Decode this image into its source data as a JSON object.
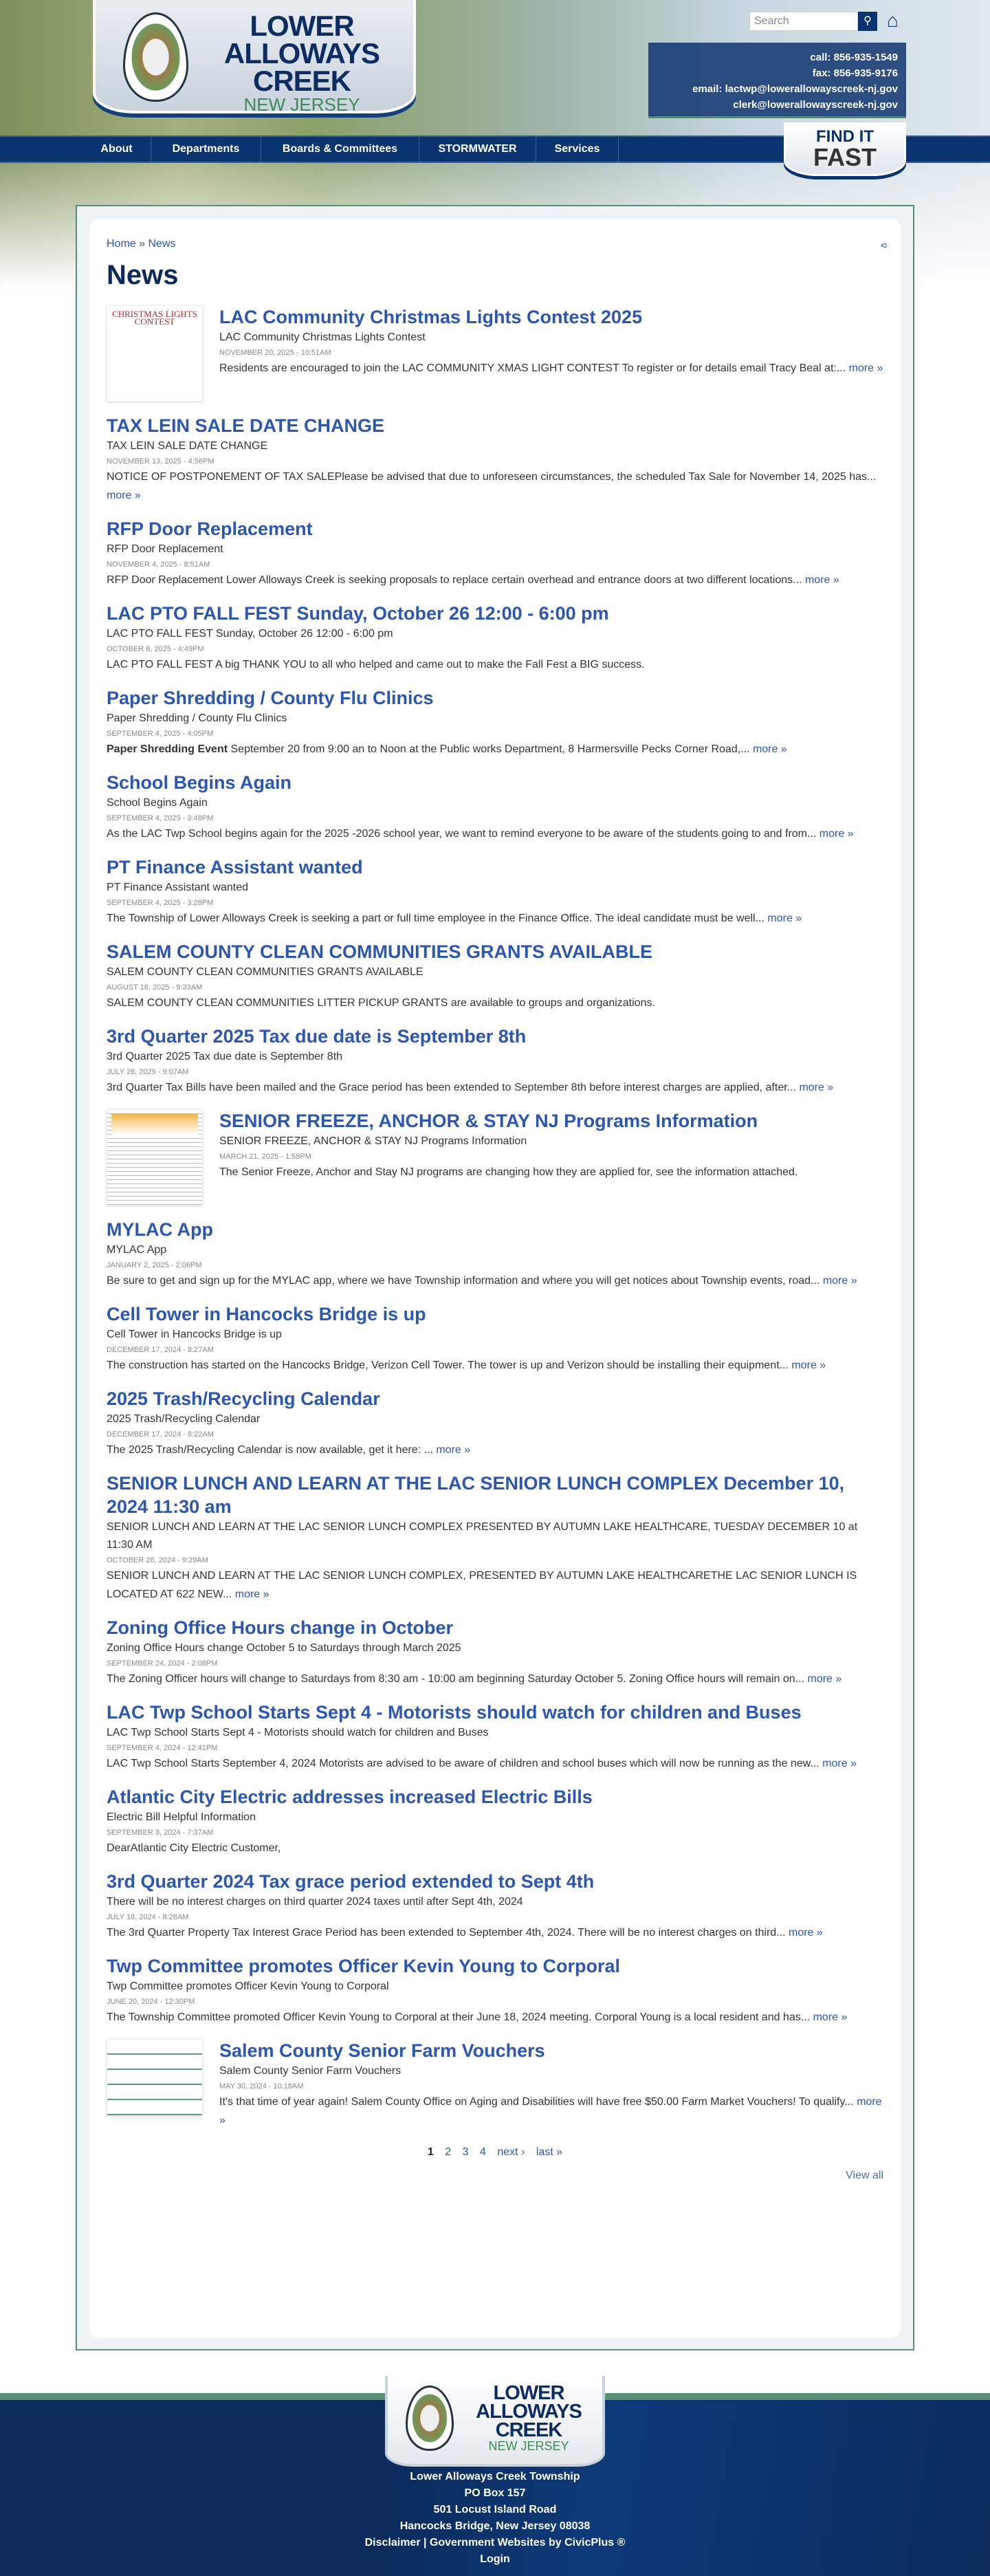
{
  "header": {
    "logo": {
      "line1": "LOWER",
      "line2": "ALLOWAYS",
      "line3": "CREEK",
      "line4": "NEW JERSEY"
    },
    "search_placeholder": "Search",
    "contact": [
      "call: 856-935-1549",
      "fax: 856-935-9176",
      "email: lactwp@lowerallowayscreek-nj.gov",
      "clerk@lowerallowayscreek-nj.gov"
    ],
    "nav": [
      "About",
      "Departments",
      "Boards & Committees",
      "STORMWATER",
      "Services"
    ],
    "find_it_fast": {
      "line1": "FIND IT",
      "line2": "FAST"
    }
  },
  "breadcrumb": {
    "home": "Home",
    "sep": " » ",
    "current": "News"
  },
  "page_title": "News",
  "news": [
    {
      "title": "LAC Community Christmas Lights Contest 2025",
      "subtitle": "LAC Community Christmas Lights Contest",
      "date": "November 20, 2025 - 10:51AM",
      "body": " Residents are encouraged to join the LAC COMMUNITY XMAS LIGHT CONTEST  To register or for details email Tracy Beal at:...",
      "more": "more »",
      "thumb_text": "CHRISTMAS LIGHTS CONTEST"
    },
    {
      "title": "TAX LEIN SALE DATE CHANGE",
      "subtitle": "TAX LEIN SALE DATE CHANGE",
      "date": "November 13, 2025 - 4:56PM",
      "body": "NOTICE OF POSTPONEMENT OF TAX SALEPlease be advised that due to unforeseen circumstances, the scheduled Tax Sale for November 14, 2025 has...",
      "more": "more »"
    },
    {
      "title": "RFP Door Replacement",
      "subtitle": "RFP Door Replacement",
      "date": "November 4, 2025 - 8:51AM",
      "body": "RFP Door Replacement  Lower Alloways Creek is seeking proposals to replace certain overhead and entrance doors at two different locations...",
      "more": "more »"
    },
    {
      "title": "LAC PTO FALL FEST Sunday, October 26 12:00 - 6:00 pm",
      "subtitle": "LAC PTO FALL FEST Sunday, October 26 12:00 - 6:00 pm",
      "date": "October 8, 2025 - 4:49PM",
      "body": "LAC PTO FALL FEST   A big THANK YOU to all who helped and came out to make the Fall Fest a BIG success."
    },
    {
      "title": "Paper Shredding / County Flu Clinics",
      "subtitle": "Paper Shredding / County Flu Clinics",
      "date": "September 4, 2025 - 4:05PM",
      "bold": "Paper Shredding Event",
      "body": " September 20 from 9:00 an to Noon at the Public works Department, 8 Harmersville Pecks Corner Road,...",
      "more": "more »"
    },
    {
      "title": "School Begins Again",
      "subtitle": "School Begins Again",
      "date": "September 4, 2025 - 3:48PM",
      "body": "As the LAC Twp School begins again for the 2025 -2026 school year, we want to remind everyone to be aware of the students going to and from...",
      "more": "more »"
    },
    {
      "title": "PT Finance Assistant wanted",
      "subtitle": "PT Finance Assistant wanted",
      "date": "September 4, 2025 - 3:28PM",
      "body": "The Township of Lower Alloways Creek is seeking a part or full time employee in the Finance Office. The ideal candidate must be well...",
      "more": "more »"
    },
    {
      "title": "SALEM COUNTY CLEAN COMMUNITIES GRANTS AVAILABLE",
      "subtitle": "SALEM COUNTY CLEAN COMMUNITIES GRANTS AVAILABLE",
      "date": "August 18, 2025 - 9:33AM",
      "body": "SALEM COUNTY CLEAN COMMUNITIES LITTER PICKUP GRANTS are available to groups and organizations."
    },
    {
      "title": "3rd Quarter 2025 Tax due date is September 8th",
      "subtitle": "3rd Quarter 2025 Tax due date is September 8th",
      "date": "July 28, 2025 - 9:07AM",
      "body": "3rd Quarter Tax Bills have been mailed and the Grace period has been extended to September 8th before interest charges are applied, after...",
      "more": "more »"
    },
    {
      "title": "SENIOR FREEZE, ANCHOR & STAY NJ Programs Information",
      "subtitle": "SENIOR FREEZE, ANCHOR & STAY NJ Programs Information",
      "date": "March 21, 2025 - 1:58PM",
      "body": "The Senior Freeze, Anchor and Stay NJ programs are changing how they are applied for, see the information attached."
    },
    {
      "title": "MYLAC App",
      "subtitle": "MYLAC App",
      "date": "January 2, 2025 - 2:06PM",
      "body": "Be sure to get and sign up for the MYLAC app, where we have Township information and where you will get notices about Township events, road...",
      "more": "more »"
    },
    {
      "title": "Cell Tower in Hancocks Bridge is up",
      "subtitle": "Cell Tower in Hancocks Bridge is up",
      "date": "December 17, 2024 - 8:27AM",
      "body": "The construction has started on the Hancocks Bridge, Verizon Cell Tower.  The tower is up and Verizon should be installing their equipment...",
      "more": "more »"
    },
    {
      "title": "2025 Trash/Recycling Calendar",
      "subtitle": "2025 Trash/Recycling Calendar",
      "date": "December 17, 2024 - 8:22AM",
      "body": "The 2025 Trash/Recycling Calendar is now available, get it here: ...",
      "more": "more »"
    },
    {
      "title": "SENIOR LUNCH AND LEARN AT THE LAC SENIOR LUNCH COMPLEX December 10, 2024 11:30 am",
      "subtitle": "SENIOR LUNCH AND LEARN AT THE LAC SENIOR LUNCH COMPLEX PRESENTED BY AUTUMN LAKE HEALTHCARE, TUESDAY DECEMBER 10 at 11:30 AM",
      "date": "October 28, 2024 - 9:29AM",
      "body": "SENIOR LUNCH AND LEARN AT THE LAC SENIOR LUNCH COMPLEX, PRESENTED BY AUTUMN LAKE HEALTHCARETHE LAC SENIOR LUNCH IS LOCATED AT 622 NEW...",
      "more": "more »"
    },
    {
      "title": "Zoning Office Hours change in October",
      "subtitle": "Zoning Office Hours change October 5 to Saturdays through March 2025",
      "date": "September 24, 2024 - 2:08PM",
      "body": "The Zoning Officer hours will change to Saturdays from 8:30 am - 10:00 am beginning Saturday October 5.  Zoning Office hours will remain on...",
      "more": "more »"
    },
    {
      "title": "LAC Twp School Starts Sept 4 - Motorists should watch for children and Buses",
      "subtitle": "LAC Twp School Starts Sept 4 - Motorists should watch for children and Buses",
      "date": "September 4, 2024 - 12:41PM",
      "body": "LAC Twp School Starts September 4, 2024 Motorists are advised to be aware of children and school buses which will now be running as the new...",
      "more": "more »"
    },
    {
      "title": "Atlantic City Electric addresses increased Electric Bills",
      "subtitle": "Electric Bill Helpful Information",
      "date": "September 3, 2024 - 7:37AM",
      "body": "DearAtlantic City Electric Customer,"
    },
    {
      "title": "3rd Quarter 2024 Tax grace period extended to Sept 4th",
      "subtitle": "There will be no interest charges on third quarter 2024 taxes until after Sept 4th, 2024",
      "date": "July 18, 2024 - 8:28AM",
      "body": "The 3rd Quarter Property Tax Interest Grace Period has been extended to September 4th, 2024. There will be no interest charges on third...",
      "more": "more »"
    },
    {
      "title": "Twp Committee promotes Officer Kevin Young to Corporal",
      "subtitle": "Twp Committee promotes Officer Kevin Young to Corporal",
      "date": "June 20, 2024 - 12:30PM",
      "body": "The Township Committee promoted Officer Kevin Young to Corporal at their June 18, 2024 meeting.  Corporal Young is a local resident and has...",
      "more": "more »"
    },
    {
      "title": "Salem County Senior Farm Vouchers",
      "subtitle": "Salem County Senior Farm Vouchers",
      "date": "May 30, 2024 - 10:18AM",
      "body": "It's that time of year again!  Salem County Office on Aging and Disabilities will have free $50.00 Farm Market Vouchers!  To qualify...",
      "more": "more »"
    }
  ],
  "pager": {
    "pages": [
      "1",
      "2",
      "3",
      "4"
    ],
    "next": "next ›",
    "last": "last »"
  },
  "view_all": "View all",
  "footer": {
    "logo": {
      "line1": "LOWER",
      "line2": "ALLOWAYS",
      "line3": "CREEK",
      "line4": "NEW JERSEY"
    },
    "lines": [
      "Lower Alloways Creek Township",
      "PO Box 157",
      "501 Locust Island Road",
      "Hancocks Bridge, New Jersey 08038"
    ],
    "disclaimer": "Disclaimer",
    "sep": " | ",
    "civicplus": "Government Websites by CivicPlus ®",
    "login": "Login"
  }
}
